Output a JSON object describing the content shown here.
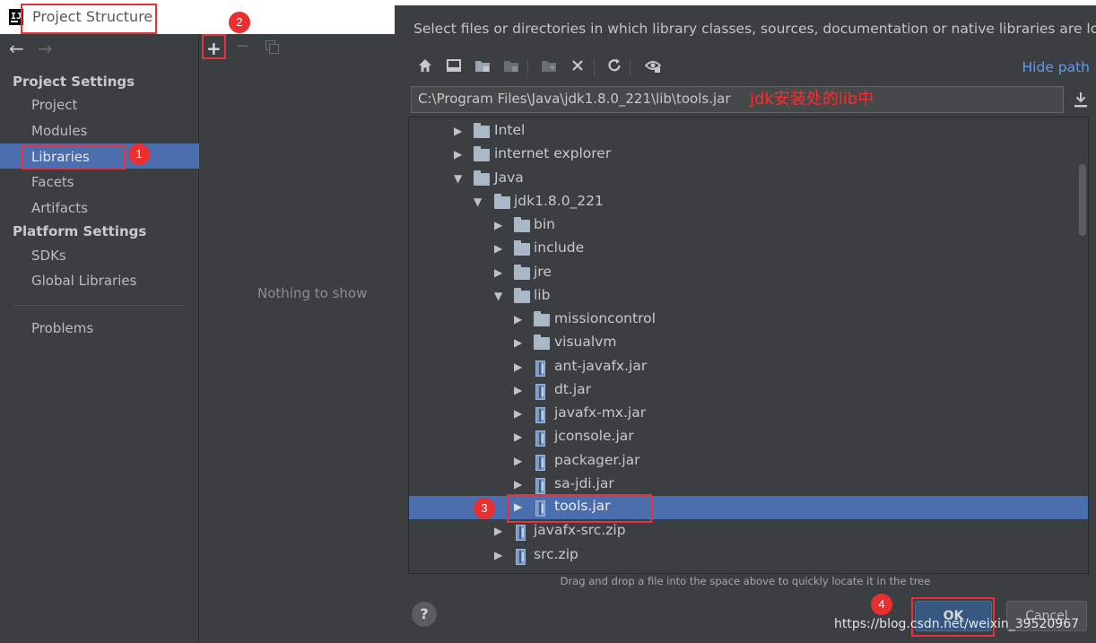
{
  "left_window": {
    "title": "Project Structure",
    "nav_back": "←",
    "nav_forward": "→",
    "sidebar": {
      "project_settings_header": "Project Settings",
      "project_settings_items": [
        "Project",
        "Modules",
        "Libraries",
        "Facets",
        "Artifacts"
      ],
      "platform_settings_header": "Platform Settings",
      "platform_settings_items": [
        "SDKs",
        "Global Libraries"
      ],
      "problems": "Problems",
      "selected": "Libraries"
    },
    "toolbar": {
      "add": "+",
      "remove": "−"
    },
    "empty_text": "Nothing to show"
  },
  "dialog": {
    "description": "Select files or directories in which library classes, sources, documentation or native libraries are located",
    "hide_path": "Hide path",
    "path_value": "C:\\Program Files\\Java\\jdk1.8.0_221\\lib\\tools.jar",
    "path_annotation": "jdk安装处的lib中",
    "tree": [
      {
        "label": "Intel",
        "type": "folder",
        "expanded": false
      },
      {
        "label": "internet explorer",
        "type": "folder",
        "expanded": false
      },
      {
        "label": "Java",
        "type": "folder",
        "expanded": true
      },
      {
        "label": "jdk1.8.0_221",
        "type": "folder",
        "expanded": true
      },
      {
        "label": "bin",
        "type": "folder",
        "expanded": false
      },
      {
        "label": "include",
        "type": "folder",
        "expanded": false
      },
      {
        "label": "jre",
        "type": "folder",
        "expanded": false
      },
      {
        "label": "lib",
        "type": "folder",
        "expanded": true
      },
      {
        "label": "missioncontrol",
        "type": "folder",
        "expanded": false
      },
      {
        "label": "visualvm",
        "type": "folder",
        "expanded": false
      },
      {
        "label": "ant-javafx.jar",
        "type": "jar",
        "expanded": false
      },
      {
        "label": "dt.jar",
        "type": "jar",
        "expanded": false
      },
      {
        "label": "javafx-mx.jar",
        "type": "jar",
        "expanded": false
      },
      {
        "label": "jconsole.jar",
        "type": "jar",
        "expanded": false
      },
      {
        "label": "packager.jar",
        "type": "jar",
        "expanded": false
      },
      {
        "label": "sa-jdi.jar",
        "type": "jar",
        "expanded": false
      },
      {
        "label": "tools.jar",
        "type": "jar",
        "expanded": false,
        "selected": true
      },
      {
        "label": "javafx-src.zip",
        "type": "jar",
        "expanded": false
      },
      {
        "label": "src.zip",
        "type": "jar",
        "expanded": false
      }
    ],
    "drag_hint": "Drag and drop a file into the space above to quickly locate it in the tree",
    "help": "?",
    "ok": "OK",
    "cancel": "Cancel",
    "toolbar_icons": [
      "home-icon",
      "desktop-icon",
      "project-folder-icon",
      "module-folder-icon",
      "new-folder-icon",
      "delete-icon",
      "refresh-icon",
      "show-hidden-icon"
    ]
  },
  "annotations": {
    "badges": [
      "1",
      "2",
      "3",
      "4"
    ],
    "highlight_color": "#e2343a"
  },
  "watermark": "https://blog.csdn.net/weixin_39520967",
  "colors": {
    "selection": "#4b6eaf",
    "link": "#589df6",
    "background": "#3c3f41"
  }
}
